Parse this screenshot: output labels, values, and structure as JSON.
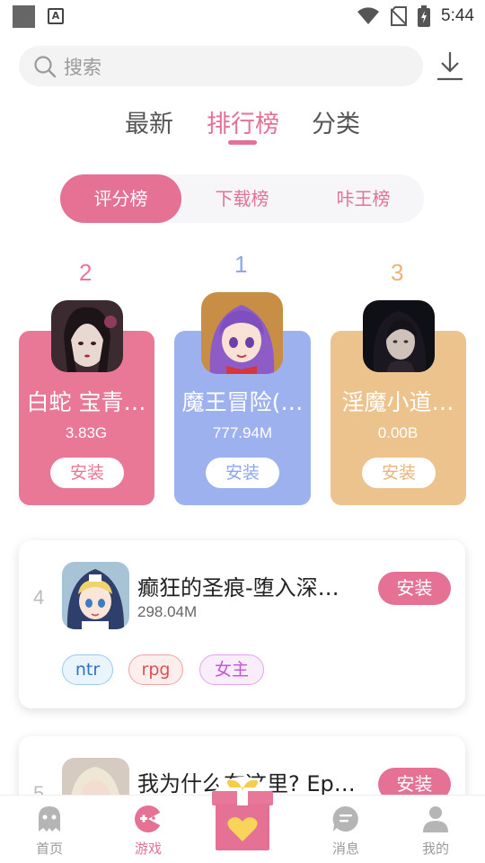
{
  "status_bar": {
    "time": "5:44",
    "notification_letter": "A"
  },
  "search": {
    "placeholder": "搜索"
  },
  "top_tabs": [
    {
      "label": "最新",
      "active": false
    },
    {
      "label": "排行榜",
      "active": true
    },
    {
      "label": "分类",
      "active": false
    }
  ],
  "segments": [
    {
      "label": "评分榜",
      "active": true
    },
    {
      "label": "下载榜",
      "active": false
    },
    {
      "label": "咔王榜",
      "active": false
    }
  ],
  "podium": [
    {
      "rank": "2",
      "title": "白蛇 宝青…",
      "size": "3.83G",
      "install_label": "安装",
      "color": "#e97897",
      "rank_color": "#e97897"
    },
    {
      "rank": "1",
      "title": "魔王冒险(…",
      "size": "777.94M",
      "install_label": "安装",
      "color": "#9db1ef",
      "rank_color": "#8ea6ec"
    },
    {
      "rank": "3",
      "title": "淫魔小道…",
      "size": "0.00B",
      "install_label": "安装",
      "color": "#ecc38d",
      "rank_color": "#eab37a"
    }
  ],
  "list": [
    {
      "rank": "4",
      "title": "癫狂的圣痕-堕入深…",
      "size": "298.04M",
      "install_label": "安装",
      "tags": [
        {
          "label": "ntr"
        },
        {
          "label": "rpg"
        },
        {
          "label": "女主"
        }
      ]
    },
    {
      "rank": "5",
      "title": "我为什么在这里? Ep…",
      "install_label": "安装"
    }
  ],
  "bottom_nav": [
    {
      "label": "首页",
      "icon": "ghost-icon",
      "active": false
    },
    {
      "label": "游戏",
      "icon": "gamepad-icon",
      "active": true
    },
    {
      "label": "",
      "icon": "gift-icon",
      "active": false
    },
    {
      "label": "消息",
      "icon": "message-icon",
      "active": false
    },
    {
      "label": "我的",
      "icon": "person-icon",
      "active": false
    }
  ],
  "colors": {
    "accent": "#e57195"
  }
}
